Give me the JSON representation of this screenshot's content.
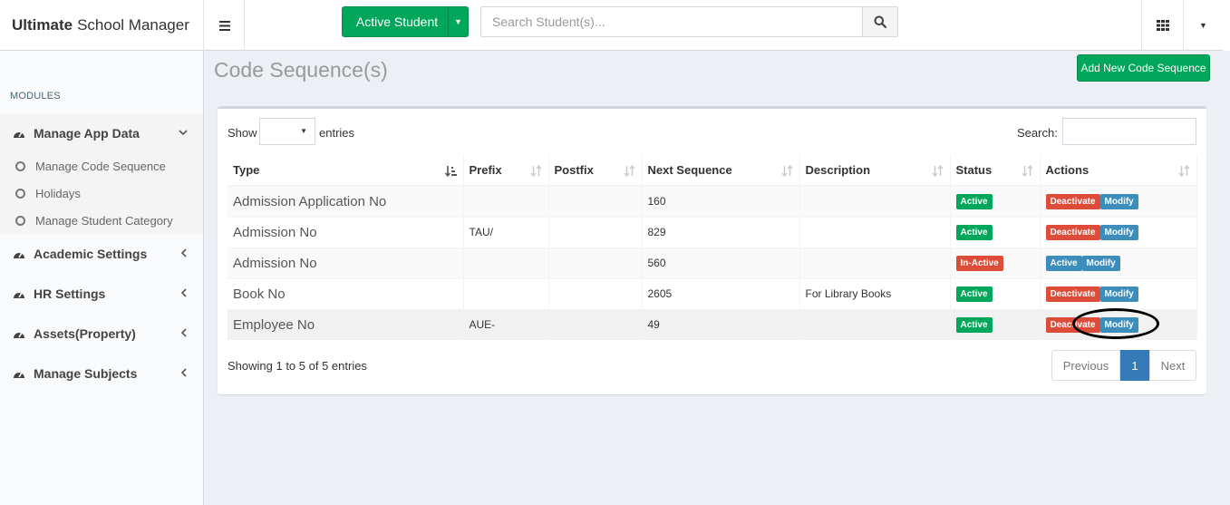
{
  "app": {
    "brand_bold": "Ultimate",
    "brand_rest": "School Manager"
  },
  "header": {
    "active_student_label": "Active Student",
    "search_placeholder": "Search Student(s)...",
    "accent_color": "#00a65a"
  },
  "sidebar": {
    "section_label": "MODULES",
    "items": [
      {
        "label": "Manage App Data",
        "icon": "dashboard-icon",
        "expanded": true
      },
      {
        "label": "Academic Settings",
        "icon": "dashboard-icon"
      },
      {
        "label": "HR Settings",
        "icon": "dashboard-icon"
      },
      {
        "label": "Assets(Property)",
        "icon": "dashboard-icon"
      },
      {
        "label": "Manage Subjects",
        "icon": "dashboard-icon"
      }
    ],
    "subitems": [
      {
        "label": "Manage Code Sequence"
      },
      {
        "label": "Holidays"
      },
      {
        "label": "Manage Student Category"
      }
    ]
  },
  "page": {
    "title": "Code Sequence(s)",
    "add_button": "Add New Code Sequence"
  },
  "table_controls": {
    "show_label": "Show",
    "entries_label": "entries",
    "search_label": "Search:"
  },
  "table": {
    "columns": [
      "Type",
      "Prefix",
      "Postfix",
      "Next Sequence",
      "Description",
      "Status",
      "Actions"
    ],
    "rows": [
      {
        "type": "Admission Application No",
        "prefix": "",
        "postfix": "",
        "next": "160",
        "description": "",
        "status": "Active",
        "action1": "Deactivate",
        "action2": "Modify"
      },
      {
        "type": "Admission No",
        "prefix": "TAU/",
        "postfix": "",
        "next": "829",
        "description": "",
        "status": "Active",
        "action1": "Deactivate",
        "action2": "Modify"
      },
      {
        "type": "Admission No",
        "prefix": "",
        "postfix": "",
        "next": "560",
        "description": "",
        "status": "In-Active",
        "action1": "Active",
        "action2": "Modify"
      },
      {
        "type": "Book No",
        "prefix": "",
        "postfix": "",
        "next": "2605",
        "description": "For Library Books",
        "status": "Active",
        "action1": "Deactivate",
        "action2": "Modify"
      },
      {
        "type": "Employee No",
        "prefix": "AUE-",
        "postfix": "",
        "next": "49",
        "description": "",
        "status": "Active",
        "action1": "Deactivate",
        "action2": "Modify"
      }
    ]
  },
  "footer": {
    "showing": "Showing 1 to 5 of 5 entries",
    "previous": "Previous",
    "page": "1",
    "next": "Next"
  }
}
